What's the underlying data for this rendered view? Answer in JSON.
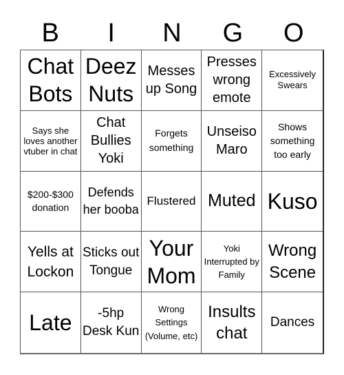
{
  "header": {
    "letters": [
      "B",
      "I",
      "N",
      "G",
      "O"
    ]
  },
  "cells": [
    {
      "text": "Chat Bots"
    },
    {
      "text": "Deez Nuts"
    },
    {
      "text": "Messes up Song"
    },
    {
      "text": "Presses wrong emote"
    },
    {
      "text": "Excessively Swears"
    },
    {
      "text": "Says she loves another vtuber in chat"
    },
    {
      "text": "Chat Bullies Yoki"
    },
    {
      "text": "Forgets something"
    },
    {
      "text": "Unseiso Maro"
    },
    {
      "text": "Shows something too early"
    },
    {
      "text": "$200-$300 donation"
    },
    {
      "text": "Defends her booba"
    },
    {
      "text": "Flustered"
    },
    {
      "text": "Muted"
    },
    {
      "text": "Kuso"
    },
    {
      "text": "Yells at Lockon"
    },
    {
      "text": "Sticks out Tongue"
    },
    {
      "text": "Your Mom"
    },
    {
      "text": "Yoki Interrupted by Family"
    },
    {
      "text": "Wrong Scene"
    },
    {
      "text": "Late"
    },
    {
      "text": "-5hp Desk Kun"
    },
    {
      "text": "Wrong Settings (Volume, etc)"
    },
    {
      "text": "Insults chat"
    },
    {
      "text": "Dances"
    }
  ]
}
